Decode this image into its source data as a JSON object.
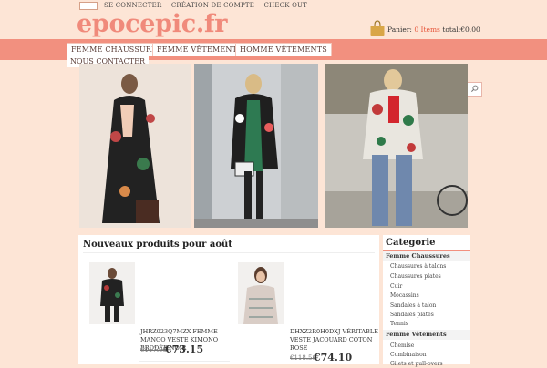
{
  "top_links": [
    "SE CONNECTER",
    "CRÉATION DE COMPTE",
    "CHECK OUT"
  ],
  "logo": "epocepic.fr",
  "cart": {
    "label": "Panier:",
    "count": "0",
    "items_label": "Items",
    "total_label": "total:",
    "total": "€0,00"
  },
  "nav": [
    "FEMME CHAUSSURES",
    "FEMME VÊTEMENTS",
    "HOMME VÊTEMENTS",
    "NOUS CONTACTER"
  ],
  "search": {
    "placeholder": ""
  },
  "products": {
    "title": "Nouveaux produits pour août",
    "items": [
      {
        "name": "JHRZ023Q7MZX FEMME MANGO VESTE KIMONO BRODÉE NOIR",
        "old_price": "€117.06",
        "price": "€73.15"
      },
      {
        "name": "DHXZ2R0H0DXJ VÉRITABLE VESTE JACQUARD COTON ROSE",
        "old_price": "€118.56",
        "price": "€74.10"
      }
    ]
  },
  "category": {
    "title": "Categorie",
    "groups": [
      {
        "label": "Femme Chaussures",
        "items": [
          "Chaussures à talons",
          "Chaussures plates",
          "Cuir",
          "Mocassins",
          "Sandales à talon",
          "Sandales plates",
          "Tennis"
        ]
      },
      {
        "label": "Femme Vêtements",
        "items": [
          "Chemise",
          "Combinaison",
          "Gilets et pull-overs"
        ]
      }
    ]
  },
  "colors": {
    "brand": "#f08a7b",
    "nav_bg": "#f2907f",
    "page_bg": "#fde5d6",
    "cart_count": "#e65338"
  }
}
